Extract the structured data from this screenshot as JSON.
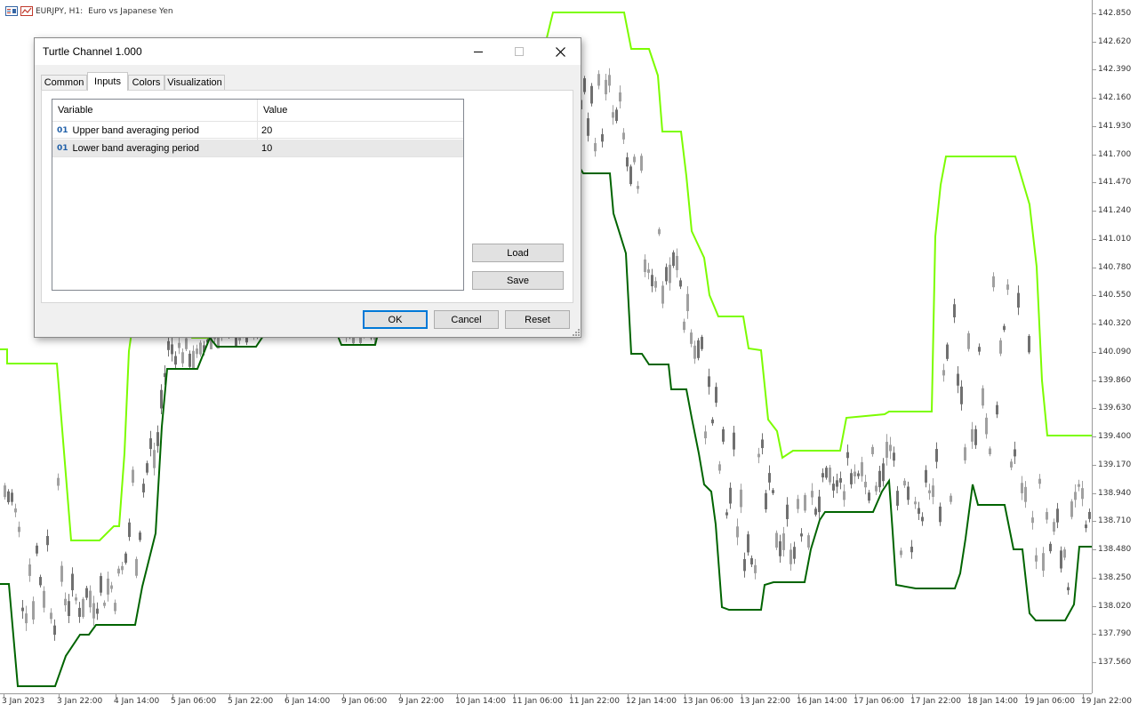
{
  "chart": {
    "symbol": "EURJPY, H1:",
    "description": "Euro vs Japanese Yen",
    "colors": {
      "upper_band": "#7cfc00",
      "lower_band": "#006400",
      "candle": "#a0a0a0",
      "candle_dark": "#707070"
    },
    "price_labels": [
      "142.850",
      "142.620",
      "142.390",
      "142.160",
      "141.930",
      "141.700",
      "141.470",
      "141.240",
      "141.010",
      "140.780",
      "140.550",
      "140.320",
      "140.090",
      "139.860",
      "139.630",
      "139.400",
      "139.170",
      "138.940",
      "138.710",
      "138.480",
      "138.250",
      "138.020",
      "137.790",
      "137.560"
    ],
    "time_labels": [
      "3 Jan 2023",
      "3 Jan 22:00",
      "4 Jan 14:00",
      "5 Jan 06:00",
      "5 Jan 22:00",
      "6 Jan 14:00",
      "9 Jan 06:00",
      "9 Jan 22:00",
      "10 Jan 14:00",
      "11 Jan 06:00",
      "11 Jan 22:00",
      "12 Jan 14:00",
      "13 Jan 06:00",
      "13 Jan 22:00",
      "16 Jan 14:00",
      "17 Jan 06:00",
      "17 Jan 22:00",
      "18 Jan 14:00",
      "19 Jan 06:00",
      "19 Jan 22:00"
    ]
  },
  "dialog": {
    "title": "Turtle Channel 1.000",
    "tabs": [
      "Common",
      "Inputs",
      "Colors",
      "Visualization"
    ],
    "active_tab": "Inputs",
    "grid": {
      "headers": [
        "Variable",
        "Value"
      ],
      "rows": [
        {
          "type_icon": "01",
          "variable": "Upper band averaging period",
          "value": "20"
        },
        {
          "type_icon": "01",
          "variable": "Lower band averaging period",
          "value": "10"
        }
      ]
    },
    "buttons": {
      "load": "Load",
      "save": "Save",
      "ok": "OK",
      "cancel": "Cancel",
      "reset": "Reset"
    }
  }
}
